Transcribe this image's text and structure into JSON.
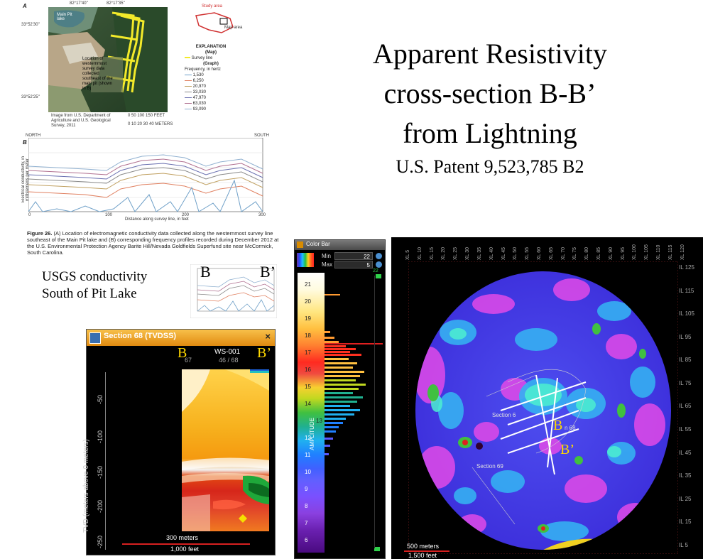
{
  "title": {
    "line1": "Apparent Resistivity",
    "line2": "cross-section B-B’",
    "line3": "from Lightning",
    "patent": "U.S. Patent 9,523,785 B2"
  },
  "usgs_figure": {
    "panel_a": "A",
    "panel_b": "B",
    "coord_top_1": "82°17'40\"",
    "coord_top_2": "82°17'35\"",
    "coord_left_1": "33°52'30\"",
    "coord_left_2": "33°52'25\"",
    "lake_label": "Main Pit lake",
    "location_note": "Location of westernmost survey data collected southeast of the main pit (shown in B)",
    "image_credit": "Image from U.S. Department of Agriculture and U.S. Geological Survey, 2011",
    "scale_feet": "0 50 100 150 FEET",
    "scale_meters": "0 10 20 30 40 METERS",
    "study_area": "Study area",
    "map_area": "Map area",
    "explanation_title": "EXPLANATION",
    "map_heading": "(Map)",
    "survey_line": "Survey line",
    "graph_heading": "(Graph)",
    "freq_heading": "Frequency, in hertz",
    "frequencies": [
      "1,530",
      "6,250",
      "20,970",
      "33,030",
      "47,970",
      "63,030",
      "93,090"
    ],
    "north": "NORTH",
    "south": "SOUTH",
    "y_axis_label": "Electrical conductivity, in millisiemens per meter",
    "x_axis_label": "Distance along survey line, in feet",
    "y_ticks": [
      "25",
      "20",
      "15",
      "10",
      "5",
      "0"
    ],
    "x_ticks": [
      "0",
      "100",
      "200",
      "300"
    ],
    "figure_caption_bold": "Figure 26.",
    "figure_caption": "(A) Location of electromagnetic conductivity data collected along the westernmost survey line southeast of the Main Pit lake and (B) corresponding frequency profiles recorded during December 2012 at the U.S. Environmental Protection Agency Barite Hill/Nevada Goldfields Superfund site near McCormick, South Carolina."
  },
  "usgs_note": {
    "line1": "USGS conductivity",
    "line2": "South of Pit Lake",
    "b_left": "B",
    "b_right": "B’"
  },
  "section_window": {
    "title": "Section 68 (TVDSS)",
    "close": "×",
    "well": "WS-001",
    "left_tick": "67",
    "right_tick": "46 / 68",
    "b_left": "B",
    "b_right": "B’",
    "y_axis_label": "TVD (meters above 0 meters)",
    "y_ticks": [
      "-50",
      "-100",
      "-150",
      "-200",
      "-250"
    ],
    "scale_meters": "300 meters",
    "scale_feet": "1,000 feet"
  },
  "color_bar": {
    "title": "Color Bar",
    "min_label": "Min",
    "min_value": "22",
    "max_label": "Max",
    "max_value": "5",
    "top_tick": "22",
    "axis_label": "AMPLITUDE",
    "ticks": [
      "21",
      "20",
      "19",
      "18",
      "17",
      "16",
      "15",
      "14",
      "13",
      "12",
      "11",
      "10",
      "9",
      "8",
      "7",
      "6"
    ]
  },
  "map_window": {
    "xl_labels": [
      "XL 5",
      "XL 10",
      "XL 15",
      "XL 20",
      "XL 25",
      "XL 30",
      "XL 35",
      "XL 40",
      "XL 45",
      "XL 50",
      "XL 55",
      "XL 60",
      "XL 65",
      "XL 70",
      "XL 75",
      "XL 80",
      "XL 85",
      "XL 90",
      "XL 95",
      "XL 100",
      "XL 105",
      "XL 110",
      "XL 115",
      "XL 120"
    ],
    "il_labels": [
      "IL 125",
      "IL 115",
      "IL 105",
      "IL 95",
      "IL 85",
      "IL 75",
      "IL 65",
      "IL 55",
      "IL 45",
      "IL 35",
      "IL 25",
      "IL 15",
      "IL 5"
    ],
    "section_label_1": "Section 6",
    "section_label_2": "n 68",
    "section_label_3": "Section 69",
    "b_left": "B",
    "b_right": "B’",
    "scale_meters": "500 meters",
    "scale_feet": "1,500 feet"
  }
}
